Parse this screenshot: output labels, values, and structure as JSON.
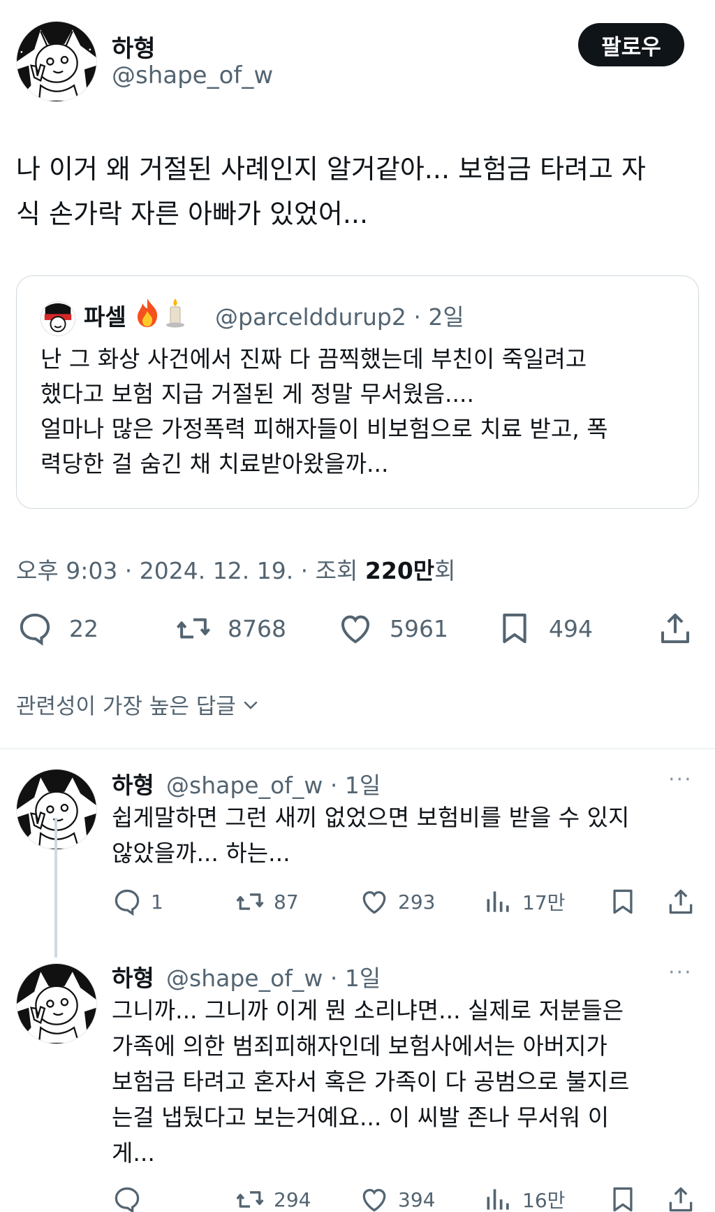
{
  "main": {
    "name": "하형",
    "handle": "@shape_of_w",
    "follow_label": "팔로우",
    "text_lines": [
      "나 이거 왜 거절된 사례인지 알거같아... 보험금 타려고 자",
      "식 손가락 자른 아빠가 있었어..."
    ]
  },
  "quote": {
    "name": "파셀",
    "emoji": "🔥 🕯️",
    "handle_time": "@parcelddurup2 · 2일",
    "text_lines": [
      "난 그 화상 사건에서 진짜 다 끔찍했는데 부친이  죽일려고",
      "했다고 보험 지급 거절된 게 정말 무서웠음....",
      "얼마나 많은 가정폭력 피해자들이 비보험으로 치료 받고, 폭",
      "력당한 걸 숨긴 채 치료받아왔을까..."
    ]
  },
  "meta": {
    "time_prefix": "오후 9:03 · 2024. 12. 19. · 조회 ",
    "views": "220만",
    "views_suffix": "회"
  },
  "actions": {
    "replies": "22",
    "retweets": "8768",
    "likes": "5961",
    "bookmarks": "494"
  },
  "replies_header": "관련성이 가장 높은 답글",
  "replies": [
    {
      "name": "하형",
      "handle_time": "@shape_of_w · 1일",
      "more": "···",
      "text_lines": [
        "쉽게말하면 그런 새끼 없었으면 보험비를 받을 수 있지",
        "않았을까... 하는..."
      ],
      "replies": "1",
      "retweets": "87",
      "likes": "293",
      "views": "17만"
    },
    {
      "name": "하형",
      "handle_time": "@shape_of_w · 1일",
      "more": "···",
      "text_lines": [
        "그니까... 그니까 이게 뭔 소리냐면... 실제로 저분들은",
        "가족에 의한 범죄피해자인데 보험사에서는 아버지가",
        "보험금 타려고 혼자서 혹은 가족이 다 공범으로 불지르",
        "는걸 냅뒀다고 보는거예요... 이 씨발 존나 무서워 이",
        "게..."
      ],
      "replies": "",
      "retweets": "294",
      "likes": "394",
      "views": "16만"
    }
  ]
}
